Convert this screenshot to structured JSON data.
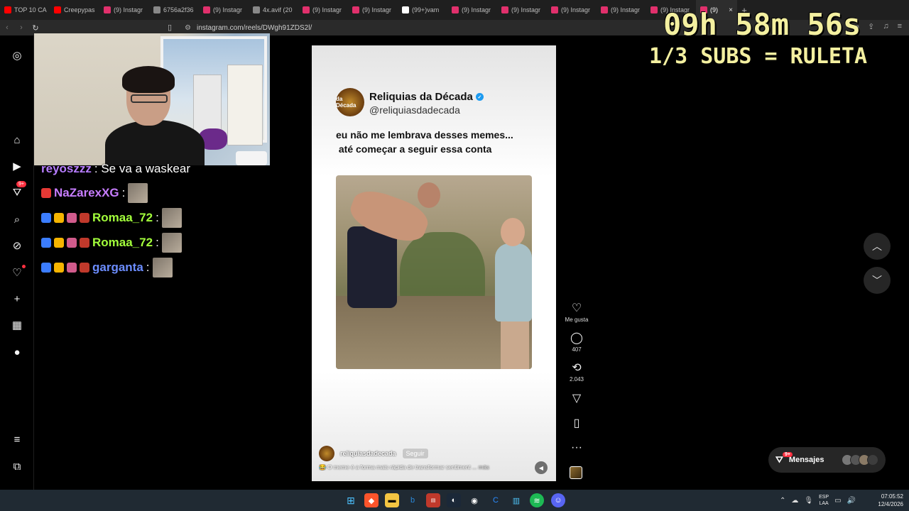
{
  "browser": {
    "tabs": [
      {
        "label": "TOP 10 CA",
        "icon": "youtube-icon",
        "color": "#ff0000"
      },
      {
        "label": "Creepypas",
        "icon": "youtube-icon",
        "color": "#ff0000"
      },
      {
        "label": "(9) Instagr",
        "icon": "instagram-icon",
        "color": "#e1306c"
      },
      {
        "label": "6756a2f36",
        "icon": "globe-icon",
        "color": "#888888"
      },
      {
        "label": "(9) Instagr",
        "icon": "instagram-icon",
        "color": "#e1306c"
      },
      {
        "label": "4x.avif (20",
        "icon": "globe-icon",
        "color": "#888888"
      },
      {
        "label": "(9) Instagr",
        "icon": "instagram-icon",
        "color": "#e1306c"
      },
      {
        "label": "(9) Instagr",
        "icon": "instagram-icon",
        "color": "#e1306c"
      },
      {
        "label": "(99+)vam",
        "icon": "tiktok-icon",
        "color": "#ffffff"
      },
      {
        "label": "(9) Instagr",
        "icon": "instagram-icon",
        "color": "#e1306c"
      },
      {
        "label": "(9) Instagr",
        "icon": "instagram-icon",
        "color": "#e1306c"
      },
      {
        "label": "(9) Instagr",
        "icon": "instagram-icon",
        "color": "#e1306c"
      },
      {
        "label": "(9) Instagr",
        "icon": "instagram-icon",
        "color": "#e1306c"
      },
      {
        "label": "(9) Instagr",
        "icon": "instagram-icon",
        "color": "#e1306c"
      },
      {
        "label": "(9)",
        "icon": "instagram-icon",
        "color": "#e1306c",
        "active": true
      }
    ],
    "new_tab": "+",
    "url": "instagram.com/reels/DWgh91ZDS2l/"
  },
  "overlay": {
    "timer": "09h 58m 56s",
    "subs_rule": "1/3 SUBS = RULETA"
  },
  "chat": [
    {
      "user": "reyoszzz",
      "color": "#b77dff",
      "message": ": Se va a waskear",
      "emote": false
    },
    {
      "user": "NaZarexXG",
      "color": "#c77dff",
      "message": ":",
      "emote": true
    },
    {
      "user": "Romaa_72",
      "color": "#a3ff3b",
      "message": ":",
      "emote": true
    },
    {
      "user": "Romaa_72",
      "color": "#a3ff3b",
      "message": ":",
      "emote": true
    },
    {
      "user": "garganta",
      "color": "#6c8dff",
      "message": ":",
      "emote": true
    }
  ],
  "sidebar": {
    "items": [
      {
        "name": "instagram-logo-icon",
        "glyph": "◎"
      },
      {
        "name": "home-icon",
        "glyph": "⌂"
      },
      {
        "name": "reels-icon",
        "glyph": "▶"
      },
      {
        "name": "explore-filter-icon",
        "glyph": "⛛",
        "badge": "9+"
      },
      {
        "name": "search-icon",
        "glyph": "⌕"
      },
      {
        "name": "compass-icon",
        "glyph": "⊘"
      },
      {
        "name": "heart-icon",
        "glyph": "♡",
        "dot": true
      },
      {
        "name": "create-icon",
        "glyph": "+"
      },
      {
        "name": "dashboard-icon",
        "glyph": "▦"
      },
      {
        "name": "profile-icon",
        "glyph": "●"
      },
      {
        "name": "menu-icon",
        "glyph": "≡"
      },
      {
        "name": "more-apps-icon",
        "glyph": "⧉"
      }
    ]
  },
  "reel": {
    "tweet_name": "Reliquias da Década",
    "tweet_handle": "@reliquiasdadecada",
    "tweet_avatar_text": "da Década",
    "tweet_text_line1": "eu não me lembrava desses memes...",
    "tweet_text_line2": " até começar a seguir essa conta",
    "author": "reliquiasdadecada",
    "follow": "Seguir",
    "caption": "😂 O meme é a forma mais rápida de transformar sentiment",
    "caption_more": " ... más"
  },
  "actions": {
    "like_label": "Me gusta",
    "comments": "407",
    "reposts": "2.043"
  },
  "messages": {
    "label": "Mensajes",
    "badge": "9+"
  },
  "taskbar": {
    "lang_top": "ESP",
    "lang_bottom": "LAA",
    "time": "07:05:52",
    "date": "12/4/2026"
  }
}
